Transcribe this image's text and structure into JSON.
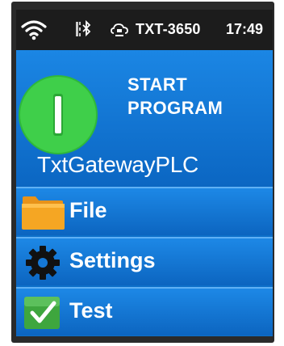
{
  "status_bar": {
    "icons": [
      "wifi-icon",
      "bluetooth-icon",
      "cloud-icon"
    ],
    "device_name": "TXT-3650",
    "time": "17:49"
  },
  "start": {
    "label_line1": "START",
    "label_line2": "PROGRAM",
    "button_color": "#3fcf4a",
    "controller_name": "TxtGatewayPLC"
  },
  "menu": {
    "items": [
      {
        "label": "File",
        "icon": "folder-icon"
      },
      {
        "label": "Settings",
        "icon": "gear-icon"
      },
      {
        "label": "Test",
        "icon": "checkmark-icon"
      }
    ]
  },
  "colors": {
    "screen_blue": "#0d6fc9",
    "status_bar": "#1c1c1c",
    "folder": "#f5a623",
    "check_green": "#3ea63e"
  }
}
